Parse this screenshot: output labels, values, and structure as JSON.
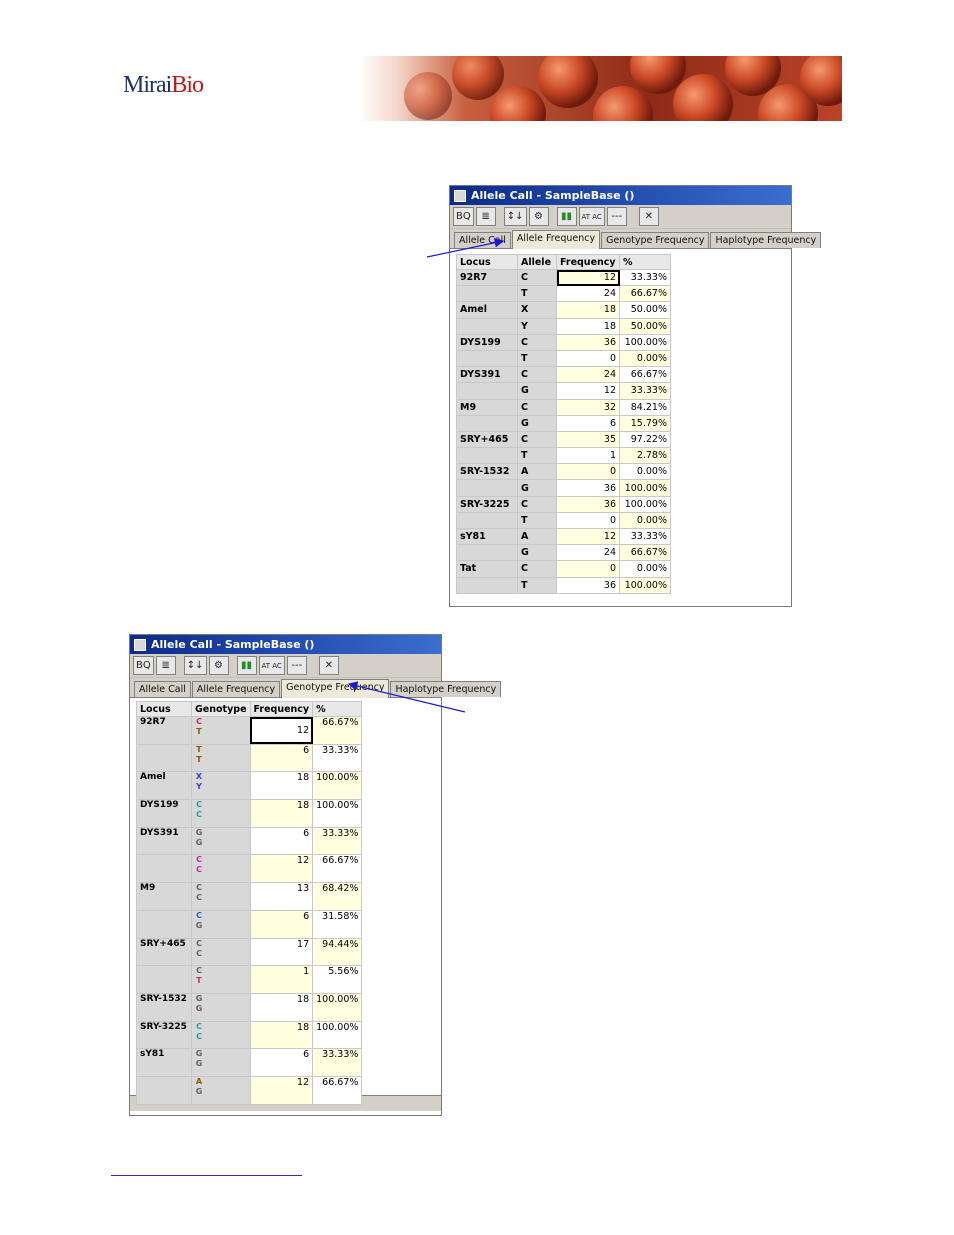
{
  "logo": {
    "part1": "Mirai",
    "part2": "Bio"
  },
  "window1": {
    "title": "Allele Call - SampleBase ()",
    "toolbar": [
      "BQ",
      "≣",
      "↕↓",
      "⚙",
      "▮▮",
      "AT AC",
      "---",
      "✕"
    ],
    "tabs": [
      "Allele Call",
      "Allele Frequency",
      "Genotype Frequency",
      "Haplotype Frequency"
    ],
    "active_tab": 1,
    "columns": [
      "Locus",
      "Allele",
      "Frequency",
      "%"
    ],
    "rows": [
      {
        "locus": "92R7",
        "allele": "C",
        "freq": "12",
        "pct": "33.33%"
      },
      {
        "locus": "",
        "allele": "T",
        "freq": "24",
        "pct": "66.67%"
      },
      {
        "locus": "Amel",
        "allele": "X",
        "freq": "18",
        "pct": "50.00%"
      },
      {
        "locus": "",
        "allele": "Y",
        "freq": "18",
        "pct": "50.00%"
      },
      {
        "locus": "DYS199",
        "allele": "C",
        "freq": "36",
        "pct": "100.00%"
      },
      {
        "locus": "",
        "allele": "T",
        "freq": "0",
        "pct": "0.00%"
      },
      {
        "locus": "DYS391",
        "allele": "C",
        "freq": "24",
        "pct": "66.67%"
      },
      {
        "locus": "",
        "allele": "G",
        "freq": "12",
        "pct": "33.33%"
      },
      {
        "locus": "M9",
        "allele": "C",
        "freq": "32",
        "pct": "84.21%"
      },
      {
        "locus": "",
        "allele": "G",
        "freq": "6",
        "pct": "15.79%"
      },
      {
        "locus": "SRY+465",
        "allele": "C",
        "freq": "35",
        "pct": "97.22%"
      },
      {
        "locus": "",
        "allele": "T",
        "freq": "1",
        "pct": "2.78%"
      },
      {
        "locus": "SRY-1532",
        "allele": "A",
        "freq": "0",
        "pct": "0.00%"
      },
      {
        "locus": "",
        "allele": "G",
        "freq": "36",
        "pct": "100.00%"
      },
      {
        "locus": "SRY-3225",
        "allele": "C",
        "freq": "36",
        "pct": "100.00%"
      },
      {
        "locus": "",
        "allele": "T",
        "freq": "0",
        "pct": "0.00%"
      },
      {
        "locus": "sY81",
        "allele": "A",
        "freq": "12",
        "pct": "33.33%"
      },
      {
        "locus": "",
        "allele": "G",
        "freq": "24",
        "pct": "66.67%"
      },
      {
        "locus": "Tat",
        "allele": "C",
        "freq": "0",
        "pct": "0.00%"
      },
      {
        "locus": "",
        "allele": "T",
        "freq": "36",
        "pct": "100.00%"
      }
    ]
  },
  "window2": {
    "title": "Allele Call - SampleBase ()",
    "toolbar": [
      "BQ",
      "≣",
      "↕↓",
      "⚙",
      "▮▮",
      "AT AC",
      "---",
      "✕"
    ],
    "tabs": [
      "Allele Call",
      "Allele Frequency",
      "Genotype Frequency",
      "Haplotype Frequency"
    ],
    "active_tab": 2,
    "columns": [
      "Locus",
      "Genotype",
      "Frequency",
      "%"
    ],
    "rows": [
      {
        "locus": "92R7",
        "g1": "C",
        "g2": "T",
        "c1": "#d02060",
        "c2": "#806000",
        "freq": "12",
        "pct": "66.67%"
      },
      {
        "locus": "",
        "g1": "T",
        "g2": "T",
        "c1": "#806000",
        "c2": "#806000",
        "freq": "6",
        "pct": "33.33%"
      },
      {
        "locus": "Amel",
        "g1": "X",
        "g2": "Y",
        "c1": "#4040c0",
        "c2": "#4040c0",
        "freq": "18",
        "pct": "100.00%"
      },
      {
        "locus": "DYS199",
        "g1": "C",
        "g2": "C",
        "c1": "#20a0a0",
        "c2": "#20a0a0",
        "freq": "18",
        "pct": "100.00%"
      },
      {
        "locus": "DYS391",
        "g1": "G",
        "g2": "G",
        "c1": "#606060",
        "c2": "#606060",
        "freq": "6",
        "pct": "33.33%"
      },
      {
        "locus": "",
        "g1": "C",
        "g2": "C",
        "c1": "#d020a0",
        "c2": "#d020a0",
        "freq": "12",
        "pct": "66.67%"
      },
      {
        "locus": "M9",
        "g1": "C",
        "g2": "C",
        "c1": "#606060",
        "c2": "#606060",
        "freq": "13",
        "pct": "68.42%"
      },
      {
        "locus": "",
        "g1": "C",
        "g2": "G",
        "c1": "#2060c0",
        "c2": "#606060",
        "freq": "6",
        "pct": "31.58%"
      },
      {
        "locus": "SRY+465",
        "g1": "C",
        "g2": "C",
        "c1": "#606060",
        "c2": "#606060",
        "freq": "17",
        "pct": "94.44%"
      },
      {
        "locus": "",
        "g1": "C",
        "g2": "T",
        "c1": "#606060",
        "c2": "#c03070",
        "freq": "1",
        "pct": "5.56%"
      },
      {
        "locus": "SRY-1532",
        "g1": "G",
        "g2": "G",
        "c1": "#606060",
        "c2": "#606060",
        "freq": "18",
        "pct": "100.00%"
      },
      {
        "locus": "SRY-3225",
        "g1": "C",
        "g2": "C",
        "c1": "#20a0a0",
        "c2": "#20a0a0",
        "freq": "18",
        "pct": "100.00%"
      },
      {
        "locus": "sY81",
        "g1": "G",
        "g2": "G",
        "c1": "#606060",
        "c2": "#606060",
        "freq": "6",
        "pct": "33.33%"
      },
      {
        "locus": "",
        "g1": "A",
        "g2": "G",
        "c1": "#806000",
        "c2": "#606060",
        "freq": "12",
        "pct": "66.67%"
      }
    ]
  }
}
